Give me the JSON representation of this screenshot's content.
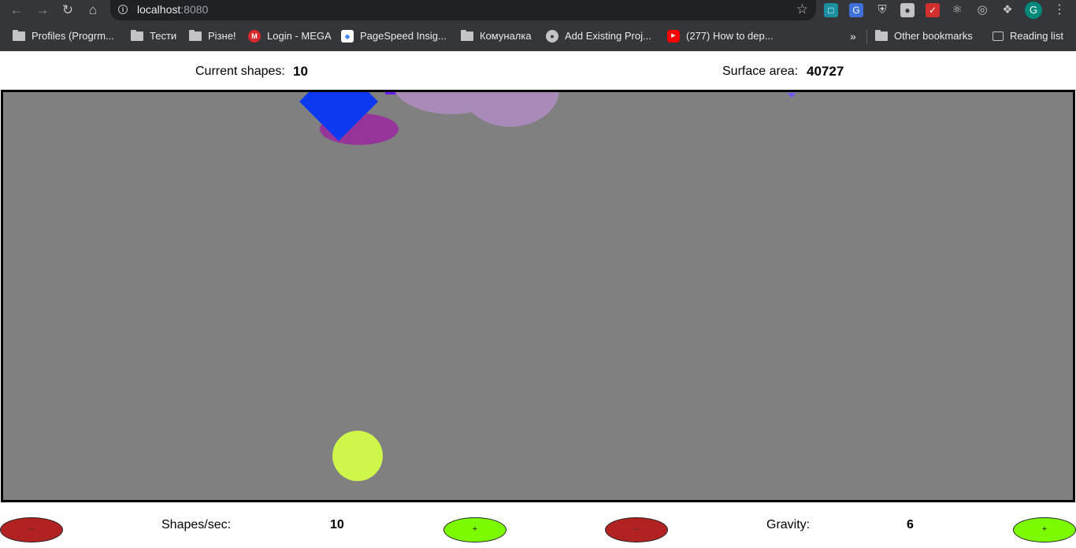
{
  "browser": {
    "url_host": "localhost",
    "url_port": ":8080",
    "bookmarks": [
      {
        "label": "Profiles (Progrm...",
        "icon": "folder-icon"
      },
      {
        "label": "Тести",
        "icon": "folder-icon"
      },
      {
        "label": "Різне!",
        "icon": "folder-icon"
      },
      {
        "label": "Login - MEGA",
        "icon": "mega-icon"
      },
      {
        "label": "PageSpeed Insig...",
        "icon": "pagespeed-icon"
      },
      {
        "label": "Комуналка",
        "icon": "folder-icon"
      },
      {
        "label": "Add Existing Proj...",
        "icon": "github-icon"
      },
      {
        "label": "(277) How to dep...",
        "icon": "youtube-icon"
      }
    ],
    "overflow_label": "»",
    "other_bookmarks": "Other bookmarks",
    "reading_list": "Reading list",
    "profile_initial": "G"
  },
  "stats": {
    "shapes_label": "Current shapes:",
    "shapes_value": "10",
    "area_label": "Surface area:",
    "area_value": "40727"
  },
  "canvas": {
    "background": "#808080",
    "shapes": [
      "blue-diamond",
      "purple-ellipse",
      "lavender-cloud",
      "violet-bar",
      "small-triangle",
      "yellow-circle"
    ]
  },
  "controls": {
    "rate_label": "Shapes/sec:",
    "rate_value": "10",
    "gravity_label": "Gravity:",
    "gravity_value": "6",
    "minus_label": "–",
    "plus_label": "+",
    "colors": {
      "minus": "#b22222",
      "plus": "#7cfc00"
    }
  }
}
